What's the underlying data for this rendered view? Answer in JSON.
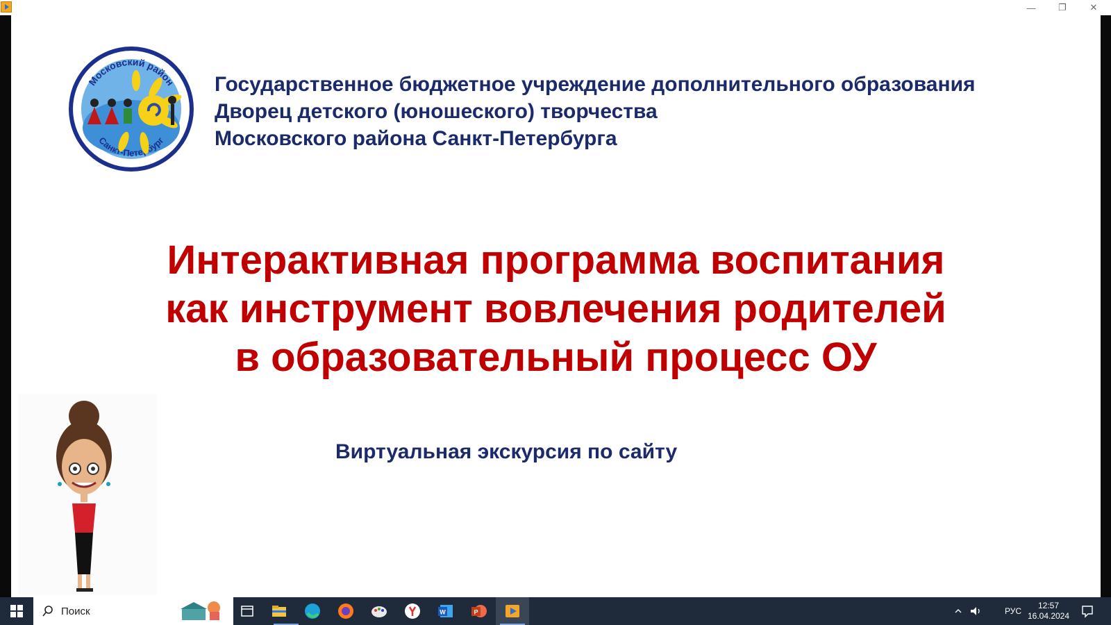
{
  "window": {
    "app_icon": "player-icon",
    "controls": {
      "minimize": "—",
      "maximize": "❐",
      "close": "✕"
    }
  },
  "slide": {
    "org_lines": [
      "Государственное бюджетное учреждение дополнительного образования",
      "Дворец детского (юношеского) творчества",
      "Московского района Санкт-Петербурга"
    ],
    "logo": {
      "top_text": "Московский район",
      "bottom_text": "Санкт-Петербург"
    },
    "headline_lines": [
      "Интерактивная программа воспитания",
      "как инструмент вовлечения родителей",
      "в образовательный процесс ОУ"
    ],
    "subtitle": "Виртуальная экскурсия по сайту"
  },
  "taskbar": {
    "search_placeholder": "Поиск",
    "lang": "РУС",
    "time": "12:57",
    "date": "16.04.2024",
    "apps": [
      "task-view-icon",
      "file-explorer-icon",
      "edge-icon",
      "firefox-icon",
      "paint-icon",
      "yandex-icon",
      "word-icon",
      "powerpoint-icon",
      "video-player-icon"
    ]
  },
  "colors": {
    "headline": "#c00000",
    "org_text": "#1b2a6b",
    "taskbar": "#1f2a3a"
  }
}
